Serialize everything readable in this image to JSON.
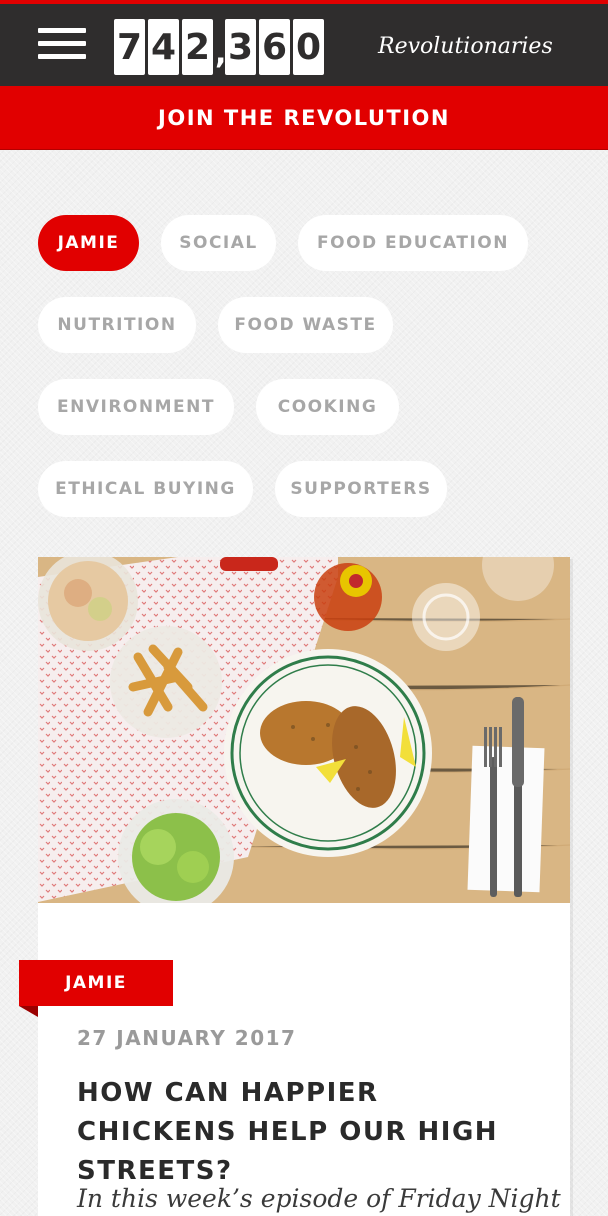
{
  "header": {
    "counter_digits": [
      "7",
      "4",
      "2",
      ",",
      "3",
      "6",
      "0"
    ],
    "counter_label": "Revolutionaries",
    "join_label": "JOIN THE REVOLUTION"
  },
  "categories": [
    {
      "label": "JAMIE",
      "active": true
    },
    {
      "label": "SOCIAL",
      "active": false
    },
    {
      "label": "FOOD EDUCATION",
      "active": false
    },
    {
      "label": "NUTRITION",
      "active": false
    },
    {
      "label": "FOOD WASTE",
      "active": false
    },
    {
      "label": "ENVIRONMENT",
      "active": false
    },
    {
      "label": "COOKING",
      "active": false
    },
    {
      "label": "ETHICAL BUYING",
      "active": false
    },
    {
      "label": "SUPPORTERS",
      "active": false
    }
  ],
  "article": {
    "tag": "JAMIE",
    "date": "27 JANUARY 2017",
    "title": "HOW CAN HAPPIER CHICKENS HELP OUR HIGH STREETS?",
    "excerpt": "In this week’s episode of Friday Night"
  },
  "colors": {
    "accent": "#e10000",
    "header_bg": "#2f2d2d",
    "pill_text": "#a7a7a7"
  }
}
